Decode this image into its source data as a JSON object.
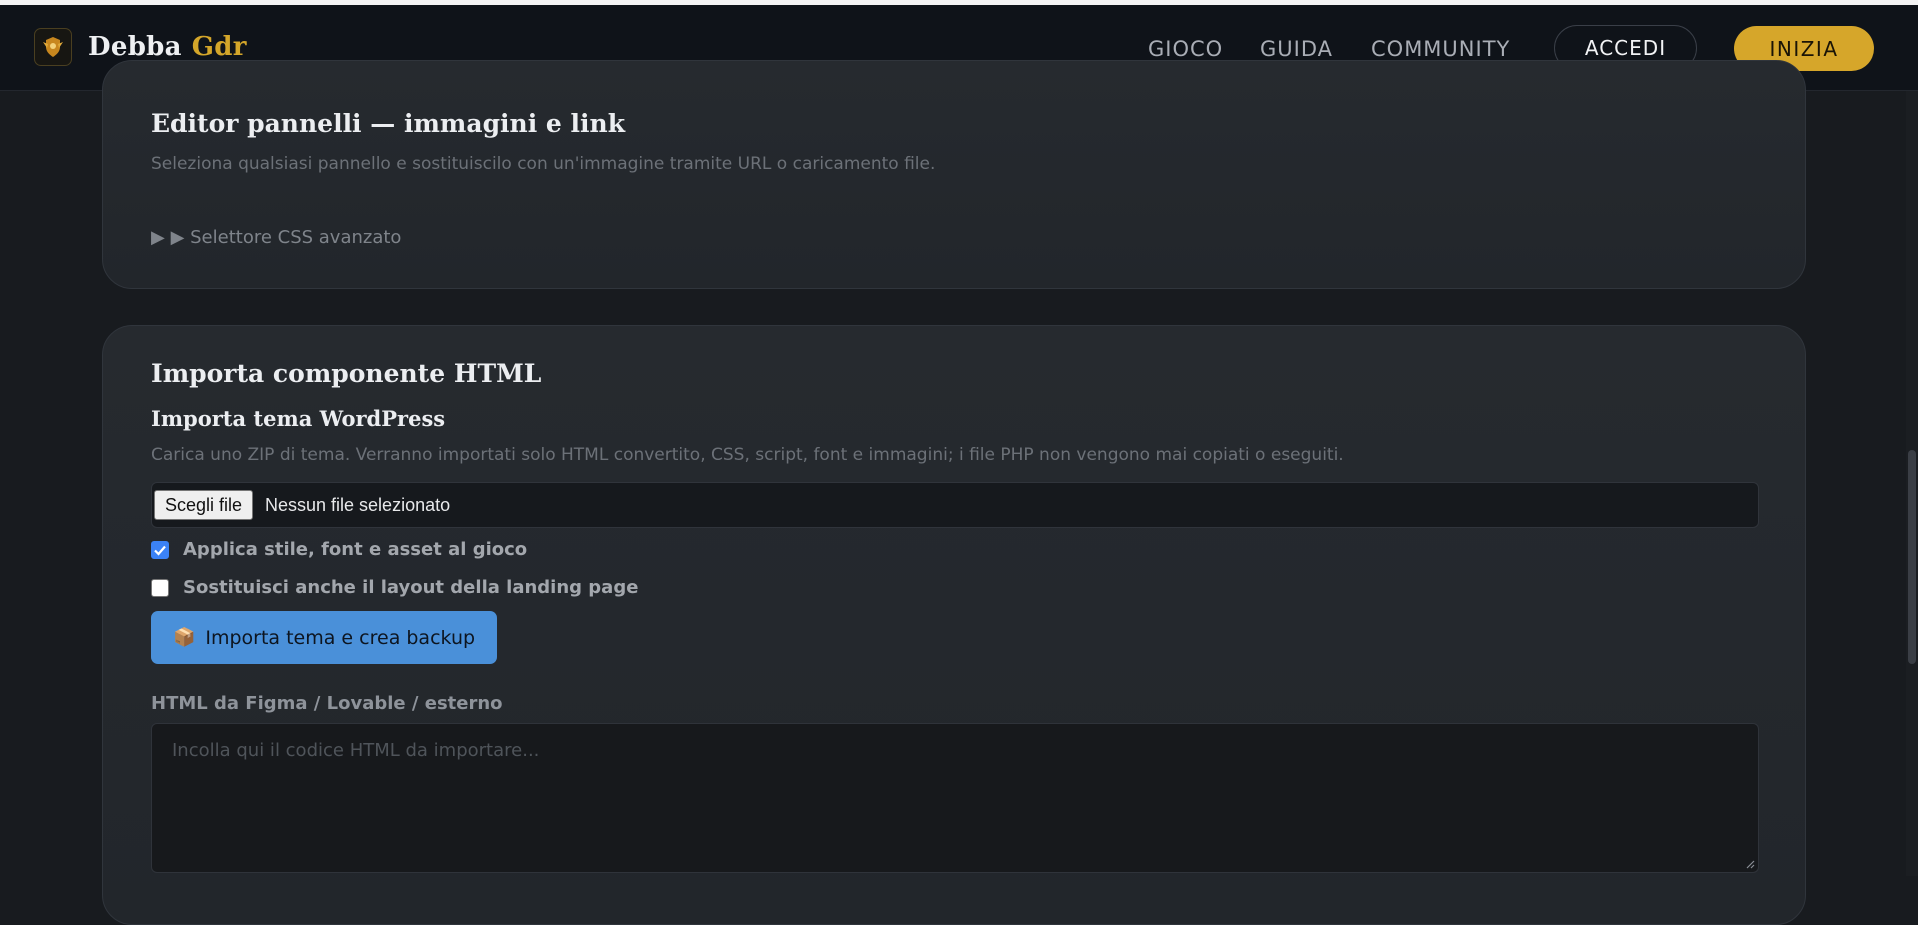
{
  "brand": {
    "name_part1": "Debba",
    "name_part2": "Gdr",
    "logo_icon": "dragon-shield-icon"
  },
  "nav": {
    "links": [
      "GIOCO",
      "GUIDA",
      "COMMUNITY"
    ],
    "login_label": "ACCEDI",
    "start_label": "INIZIA"
  },
  "panel_editor": {
    "title": "Editor pannelli — immagini e link",
    "description": "Seleziona qualsiasi pannello e sostituiscilo con un'immagine tramite URL o caricamento file.",
    "advanced_selector_label": "▶ ▶ Selettore CSS avanzato"
  },
  "import_component": {
    "title": "Importa componente HTML",
    "wordpress": {
      "title": "Importa tema WordPress",
      "description": "Carica uno ZIP di tema. Verranno importati solo HTML convertito, CSS, script, font e immagini; i file PHP non vengono mai copiati o eseguiti.",
      "file_button_label": "Scegli file",
      "file_status": "Nessun file selezionato",
      "option_apply_style": {
        "label": "Applica stile, font e asset al gioco",
        "checked": true
      },
      "option_replace_layout": {
        "label": "Sostituisci anche il layout della landing page",
        "checked": false
      },
      "import_button_icon": "📦",
      "import_button_label": "Importa tema e crea backup"
    },
    "html_field": {
      "label": "HTML da Figma / Lovable / esterno",
      "placeholder": "Incolla qui il codice HTML da importare..."
    }
  },
  "colors": {
    "accent_gold": "#d6a62a",
    "primary_blue": "#4a90d9",
    "background": "#181b1f"
  }
}
